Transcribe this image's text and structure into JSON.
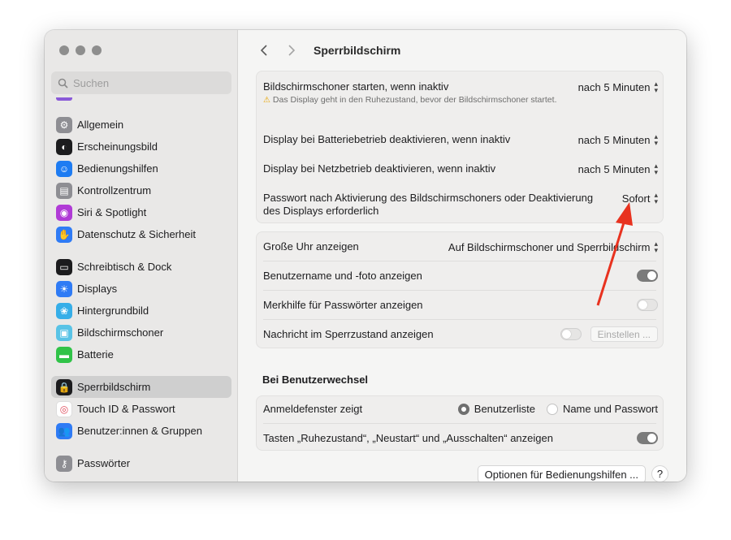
{
  "search": {
    "placeholder": "Suchen"
  },
  "sidebar": {
    "items": [
      {
        "label": "Allgemein",
        "icon": "gear-icon",
        "color": "#8e8e93"
      },
      {
        "label": "Erscheinungsbild",
        "icon": "appearance-icon",
        "color": "#1c1c1e"
      },
      {
        "label": "Bedienungshilfen",
        "icon": "accessibility-icon",
        "color": "#1e7cf2"
      },
      {
        "label": "Kontrollzentrum",
        "icon": "control-center-icon",
        "color": "#8e8e93"
      },
      {
        "label": "Siri & Spotlight",
        "icon": "siri-icon",
        "color": "#b03bd6"
      },
      {
        "label": "Datenschutz & Sicherheit",
        "icon": "hand-icon",
        "color": "#2f7bf5"
      },
      {
        "label": "Schreibtisch & Dock",
        "icon": "dock-icon",
        "color": "#1c1c1e"
      },
      {
        "label": "Displays",
        "icon": "sun-icon",
        "color": "#2f7bf5"
      },
      {
        "label": "Hintergrundbild",
        "icon": "wallpaper-icon",
        "color": "#36aee8"
      },
      {
        "label": "Bildschirmschoner",
        "icon": "screensaver-icon",
        "color": "#59c3e6"
      },
      {
        "label": "Batterie",
        "icon": "battery-icon",
        "color": "#30c348"
      },
      {
        "label": "Sperrbildschirm",
        "icon": "lock-icon",
        "color": "#1c1c1e"
      },
      {
        "label": "Touch ID & Passwort",
        "icon": "fingerprint-icon",
        "color": "#ffffff"
      },
      {
        "label": "Benutzer:innen & Gruppen",
        "icon": "users-icon",
        "color": "#2f7bf5"
      },
      {
        "label": "Passwörter",
        "icon": "key-icon",
        "color": "#8e8e93"
      }
    ],
    "active": "Sperrbildschirm"
  },
  "header": {
    "title": "Sperrbildschirm"
  },
  "group1": {
    "screensaver_label": "Bildschirmschoner starten, wenn inaktiv",
    "screensaver_value": "nach 5 Minuten",
    "screensaver_warning": "Das Display geht in den Ruhezustand, bevor der Bildschirmschoner startet.",
    "battery_label": "Display bei Batteriebetrieb deaktivieren, wenn inaktiv",
    "battery_value": "nach 5 Minuten",
    "power_label": "Display bei Netzbetrieb deaktivieren, wenn inaktiv",
    "power_value": "nach 5 Minuten",
    "password_label": "Passwort nach Aktivierung des Bildschirmschoners oder Deaktivierung des Displays erforderlich",
    "password_value": "Sofort"
  },
  "group2": {
    "clock_label": "Große Uhr anzeigen",
    "clock_value": "Auf Bildschirmschoner und Sperrbildschirm",
    "username_label": "Benutzername und -foto anzeigen",
    "username_on": true,
    "hint_label": "Merkhilfe für Passwörter anzeigen",
    "hint_on": false,
    "message_label": "Nachricht im Sperrzustand anzeigen",
    "message_on": false,
    "message_button": "Einstellen ..."
  },
  "user_switch": {
    "title": "Bei Benutzerwechsel",
    "login_label": "Anmeldefenster zeigt",
    "option_list": "Benutzerliste",
    "option_name": "Name und Passwort",
    "selected": "Benutzerliste",
    "buttons_label": "Tasten „Ruhezustand“, „Neustart“ und „Ausschalten“ anzeigen",
    "buttons_on": true
  },
  "footer": {
    "accessibility_button": "Optionen für Bedienungshilfen ...",
    "help_button": "?"
  },
  "annotation": {
    "arrow_color": "#e8321f"
  }
}
